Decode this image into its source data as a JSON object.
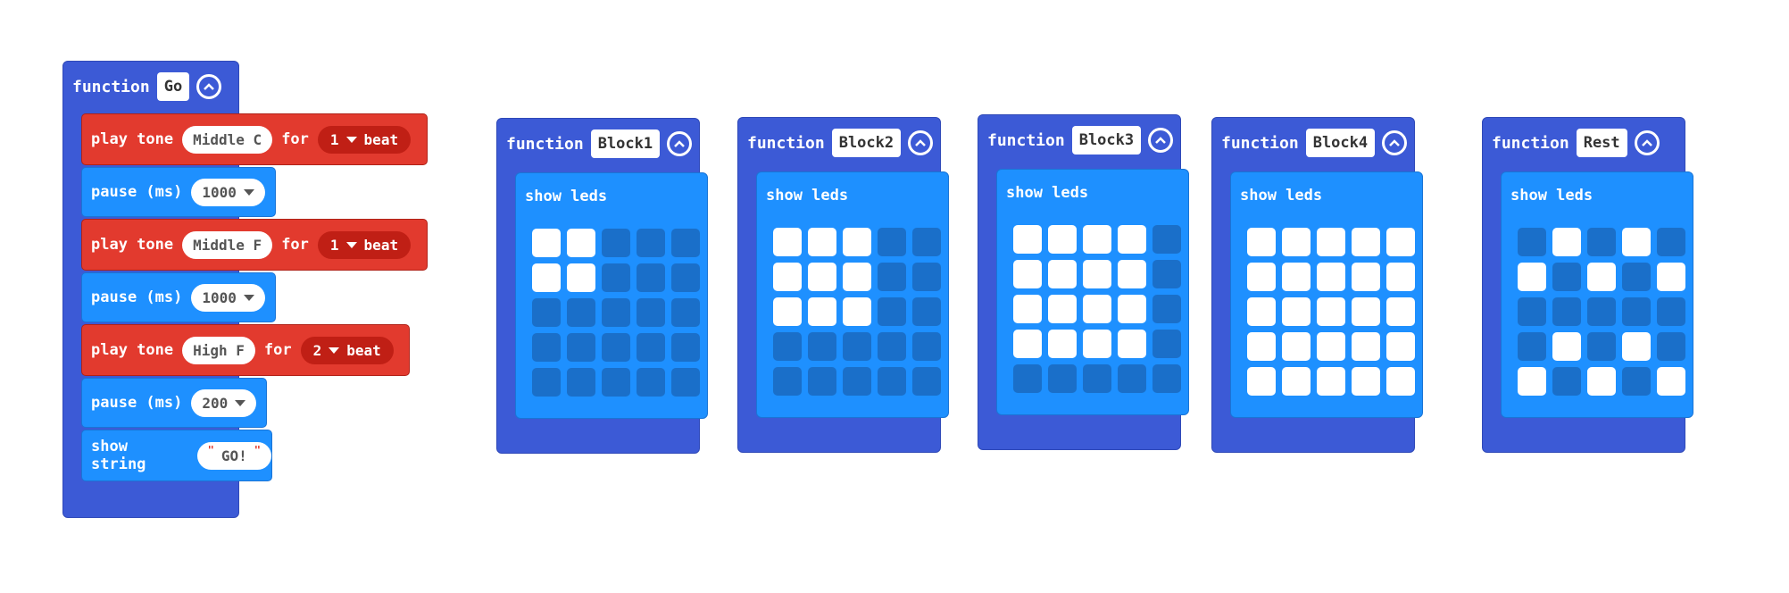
{
  "colors": {
    "function_block": "#3c5ad6",
    "music_block": "#e23a2e",
    "basic_block": "#1e90ff",
    "led_on": "#ffffff",
    "led_off": "#1a6fc9"
  },
  "icons": {
    "collapse": "chevron-up-circle-icon",
    "dropdown": "triangle-down-icon"
  },
  "go_function": {
    "keyword": "function",
    "name": "Go",
    "blocks": [
      {
        "type": "play_tone",
        "label": "play tone",
        "note": "Middle C",
        "for_label": "for",
        "beat": "1",
        "beat_unit": "beat"
      },
      {
        "type": "pause",
        "label": "pause (ms)",
        "value": "1000"
      },
      {
        "type": "play_tone",
        "label": "play tone",
        "note": "Middle F",
        "for_label": "for",
        "beat": "1",
        "beat_unit": "beat"
      },
      {
        "type": "pause",
        "label": "pause (ms)",
        "value": "1000"
      },
      {
        "type": "play_tone",
        "label": "play tone",
        "note": "High F",
        "for_label": "for",
        "beat": "2",
        "beat_unit": "beat"
      },
      {
        "type": "pause",
        "label": "pause (ms)",
        "value": "200"
      },
      {
        "type": "show_string",
        "label": "show string",
        "value": "GO!"
      }
    ]
  },
  "led_functions": [
    {
      "keyword": "function",
      "name": "Block1",
      "show_label": "show leds",
      "leds": [
        [
          1,
          1,
          0,
          0,
          0
        ],
        [
          1,
          1,
          0,
          0,
          0
        ],
        [
          0,
          0,
          0,
          0,
          0
        ],
        [
          0,
          0,
          0,
          0,
          0
        ],
        [
          0,
          0,
          0,
          0,
          0
        ]
      ]
    },
    {
      "keyword": "function",
      "name": "Block2",
      "show_label": "show leds",
      "leds": [
        [
          1,
          1,
          1,
          0,
          0
        ],
        [
          1,
          1,
          1,
          0,
          0
        ],
        [
          1,
          1,
          1,
          0,
          0
        ],
        [
          0,
          0,
          0,
          0,
          0
        ],
        [
          0,
          0,
          0,
          0,
          0
        ]
      ]
    },
    {
      "keyword": "function",
      "name": "Block3",
      "show_label": "show leds",
      "leds": [
        [
          1,
          1,
          1,
          1,
          0
        ],
        [
          1,
          1,
          1,
          1,
          0
        ],
        [
          1,
          1,
          1,
          1,
          0
        ],
        [
          1,
          1,
          1,
          1,
          0
        ],
        [
          0,
          0,
          0,
          0,
          0
        ]
      ]
    },
    {
      "keyword": "function",
      "name": "Block4",
      "show_label": "show leds",
      "leds": [
        [
          1,
          1,
          1,
          1,
          1
        ],
        [
          1,
          1,
          1,
          1,
          1
        ],
        [
          1,
          1,
          1,
          1,
          1
        ],
        [
          1,
          1,
          1,
          1,
          1
        ],
        [
          1,
          1,
          1,
          1,
          1
        ]
      ]
    },
    {
      "keyword": "function",
      "name": "Rest",
      "show_label": "show leds",
      "leds": [
        [
          0,
          1,
          0,
          1,
          0
        ],
        [
          1,
          0,
          1,
          0,
          1
        ],
        [
          0,
          0,
          0,
          0,
          0
        ],
        [
          0,
          1,
          0,
          1,
          0
        ],
        [
          1,
          0,
          1,
          0,
          1
        ]
      ]
    }
  ]
}
